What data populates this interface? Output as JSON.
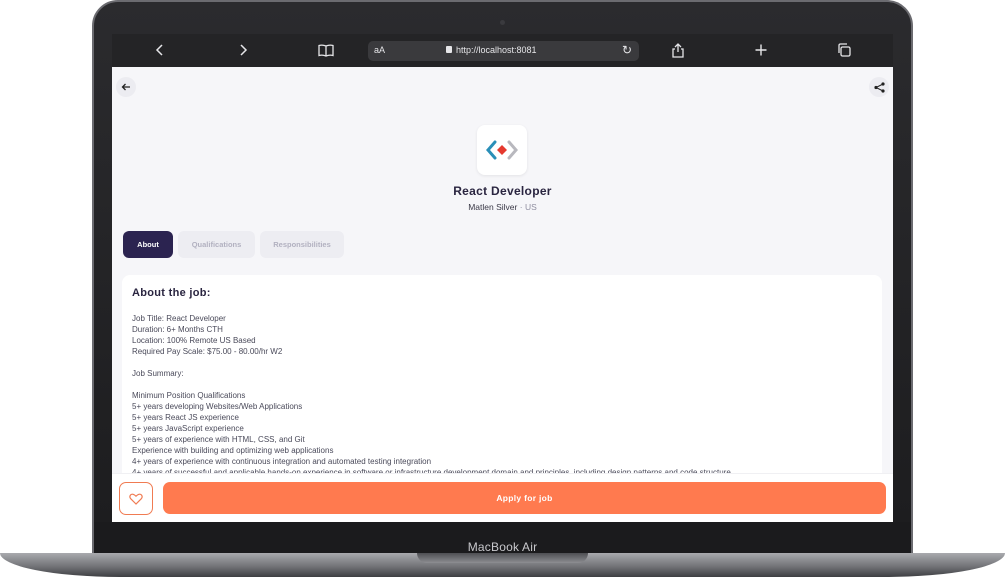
{
  "device": {
    "model_label": "MacBook Air"
  },
  "browser": {
    "text_size_label": "aA",
    "url": "http://localhost:8081",
    "icons": [
      "chevron-left-icon",
      "chevron-right-icon",
      "book-icon",
      "lock-icon",
      "reload-icon",
      "share-icon",
      "plus-icon",
      "tabs-icon"
    ]
  },
  "job": {
    "title": "React Developer",
    "company": "Matlen Silver",
    "location_separator": "·",
    "location": "US"
  },
  "tabs": [
    {
      "label": "About",
      "active": true
    },
    {
      "label": "Qualifications",
      "active": false
    },
    {
      "label": "Responsibilities",
      "active": false
    }
  ],
  "about": {
    "heading": "About the job:",
    "lines": [
      "Job Title: React Developer",
      "Duration: 6+ Months CTH",
      "Location: 100% Remote US Based",
      "Required Pay Scale: $75.00 - 80.00/hr W2",
      "",
      "Job Summary:",
      "",
      "Minimum Position Qualifications",
      "5+ years developing Websites/Web Applications",
      "5+ years React JS experience",
      "5+ years JavaScript experience",
      "5+ years of experience with HTML, CSS, and Git",
      "Experience with building and optimizing web applications",
      "4+ years of experience with continuous integration and automated testing integration",
      "4+ years of successful and applicable hands-on experience in software or infrastructure development domain and principles, including design patterns and code structure"
    ]
  },
  "actions": {
    "apply_label": "Apply for job"
  },
  "colors": {
    "accent": "#ff7a4f",
    "active_tab": "#2b2350",
    "page_bg": "#f6f6f9",
    "heading": "#2a2540"
  }
}
